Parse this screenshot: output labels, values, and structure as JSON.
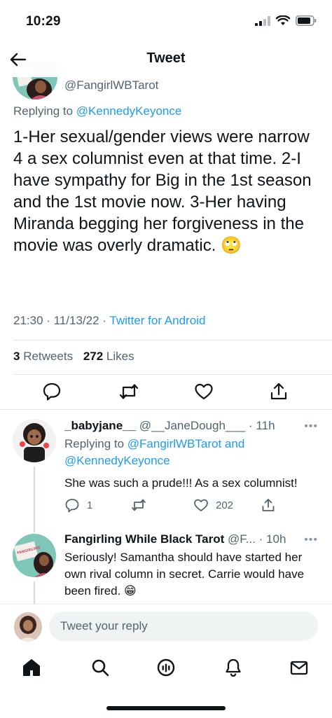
{
  "status_bar": {
    "time": "10:29"
  },
  "header": {
    "title": "Tweet"
  },
  "tweet": {
    "handle": "@FangirlWBTarot",
    "replying_prefix": "Replying to ",
    "replying_to": "@KennedyKeyonce",
    "text": "1-Her sexual/gender views were narrow 4 a sex columnist even at that time. 2-I have sympathy for Big in the 1st season and the 1st movie now. 3-Her having Miranda begging her forgiveness in the movie was overly dramatic. 🙄",
    "time": "21:30",
    "date": "11/13/22",
    "separator": " · ",
    "source": "Twitter for Android",
    "retweets_count": "3",
    "retweets_label": "Retweets",
    "likes_count": "272",
    "likes_label": "Likes"
  },
  "replies": [
    {
      "name": "_babyjane__",
      "handle": "@__JaneDough___",
      "time": "11h",
      "replying_prefix": "Replying to ",
      "replying_to_1": "@FangirlWBTarot",
      "replying_join": " and",
      "replying_to_2": "@KennedyKeyonce",
      "text": "She was such a prude!!! As a sex columnist!",
      "reply_count": "1",
      "like_count": "202"
    },
    {
      "name": "Fangirling While Black Tarot",
      "handle": "@F...",
      "time": "10h",
      "text": "Seriously! Samantha should have started her own rival column in secret. Carrie would have been fired. 😁",
      "avatar_text": "FANGIRLING WHILE BLACK"
    }
  ],
  "dot": "·",
  "more": "•••",
  "compose": {
    "placeholder": "Tweet your reply"
  },
  "icons": {
    "back": "arrow-left-icon",
    "reply": "speech-bubble-icon",
    "retweet": "retweet-icon",
    "like": "heart-icon",
    "share": "share-icon",
    "home": "home-icon",
    "search": "search-icon",
    "spaces": "spaces-icon",
    "notifications": "bell-icon",
    "messages": "envelope-icon"
  },
  "colors": {
    "accent": "#1d9bf0",
    "text": "#0f1419",
    "secondary": "#536471",
    "divider": "#e3e8eb"
  }
}
